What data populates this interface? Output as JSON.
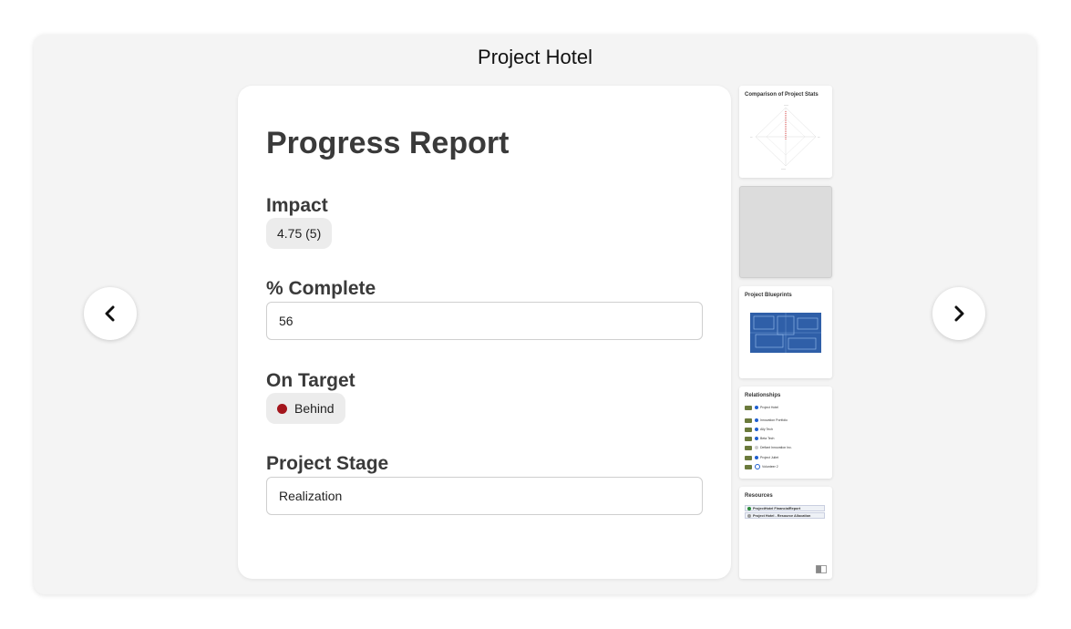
{
  "window": {
    "title": "Project Hotel"
  },
  "nav": {
    "prev_icon": "chevron-left-icon",
    "next_icon": "chevron-right-icon"
  },
  "report": {
    "heading": "Progress Report",
    "impact": {
      "label": "Impact",
      "value": "4.75 (5)"
    },
    "complete": {
      "label": "% Complete",
      "value": "56"
    },
    "on_target": {
      "label": "On Target",
      "value": "Behind",
      "status_color": "#a3151c"
    },
    "stage": {
      "label": "Project Stage",
      "value": "Realization"
    }
  },
  "thumbnails": {
    "stats": {
      "title": "Comparison of Project Stats"
    },
    "blueprints": {
      "title": "Project Blueprints"
    },
    "relationships": {
      "title": "Relationships",
      "items": [
        "Project Hotel",
        "Innovation Portfolio",
        "Ally Tech",
        "Beta Tech",
        "Defiant Innovation Inc.",
        "Project Juliet",
        "Volunteer 2"
      ]
    },
    "resources": {
      "title": "Resources",
      "items": [
        "ProjectHotel FinancialReport",
        "Project Hotel - Resource Allocation"
      ]
    }
  },
  "colors": {
    "accent_blue": "#1f5fcf",
    "blueprint": "#2f5fa8"
  }
}
